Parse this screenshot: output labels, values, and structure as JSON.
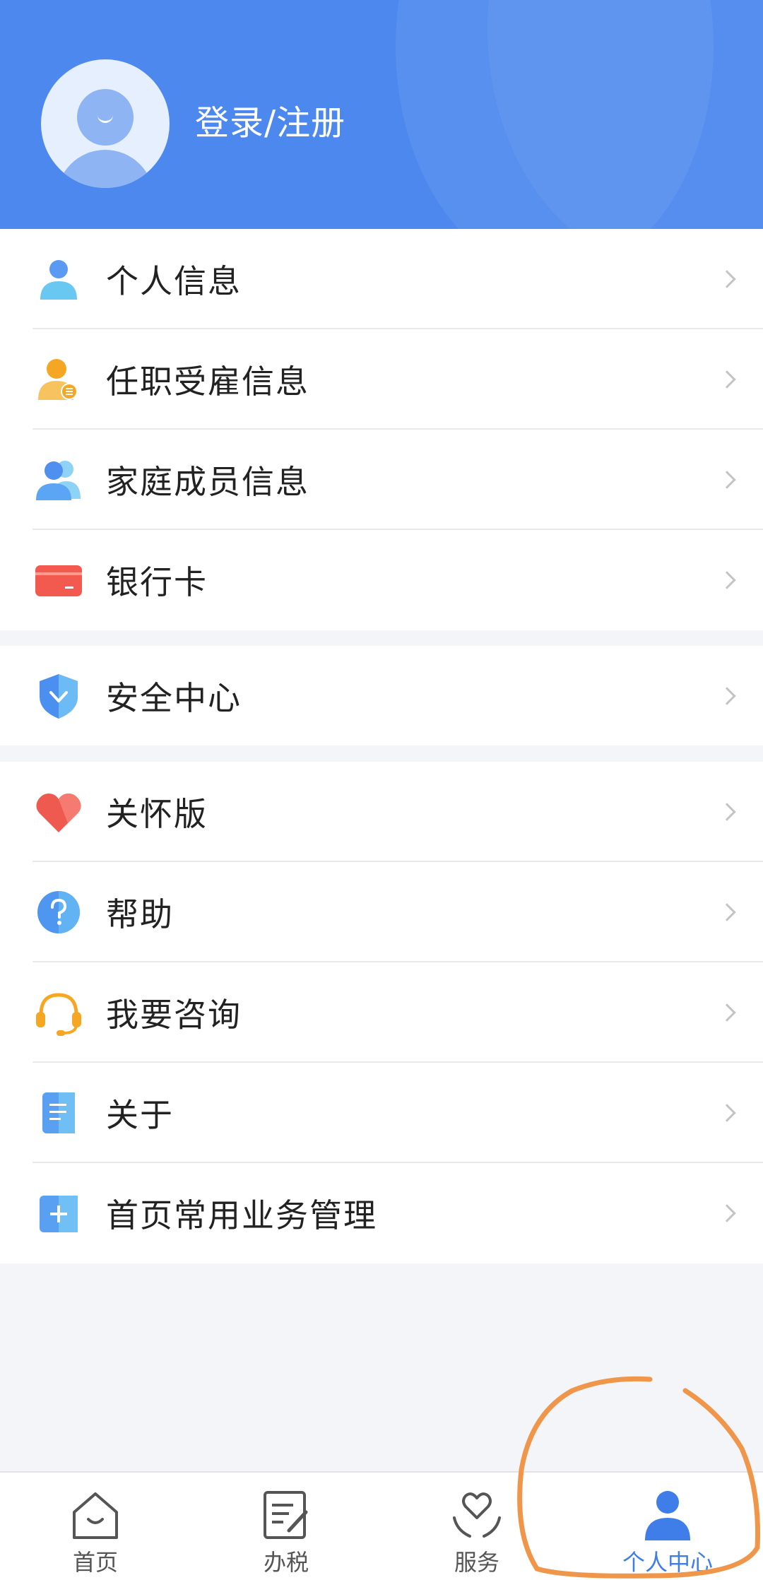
{
  "header": {
    "login_label": "登录/注册"
  },
  "group1": [
    {
      "label": "个人信息",
      "icon": "person-icon"
    },
    {
      "label": "任职受雇信息",
      "icon": "employment-icon"
    },
    {
      "label": "家庭成员信息",
      "icon": "family-icon"
    },
    {
      "label": "银行卡",
      "icon": "bank-card-icon"
    }
  ],
  "group2": [
    {
      "label": "安全中心",
      "icon": "shield-icon"
    }
  ],
  "group3": [
    {
      "label": "关怀版",
      "icon": "heart-icon"
    },
    {
      "label": "帮助",
      "icon": "question-icon"
    },
    {
      "label": "我要咨询",
      "icon": "headset-icon"
    },
    {
      "label": "关于",
      "icon": "document-icon"
    },
    {
      "label": "首页常用业务管理",
      "icon": "plus-icon"
    }
  ],
  "tabs": [
    {
      "label": "首页",
      "icon": "home-icon",
      "active": false
    },
    {
      "label": "办税",
      "icon": "tax-edit-icon",
      "active": false
    },
    {
      "label": "服务",
      "icon": "service-heart-icon",
      "active": false
    },
    {
      "label": "个人中心",
      "icon": "user-center-icon",
      "active": true
    }
  ],
  "colors": {
    "header_bg": "#4c88ee",
    "active_tab": "#3f7ee8",
    "annotation": "#f0964a"
  }
}
